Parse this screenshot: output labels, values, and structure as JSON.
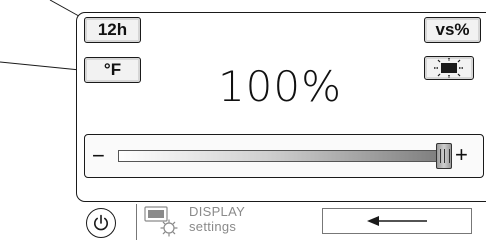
{
  "mode_buttons": {
    "time_format_label": "12h",
    "temperature_unit_label": "°F",
    "vs_label": "vs%"
  },
  "display": {
    "value": "100%",
    "brightness_level_percent": 100
  },
  "slider": {
    "minus_label": "−",
    "plus_label": "+"
  },
  "bottom_bar": {
    "display_settings_line1": "DISPLAY",
    "display_settings_line2": "settings",
    "icons": {
      "power": "power-icon",
      "display_settings": "display-settings-icon",
      "back": "arrow-left-icon",
      "screen": "screen-brightness-icon"
    }
  }
}
